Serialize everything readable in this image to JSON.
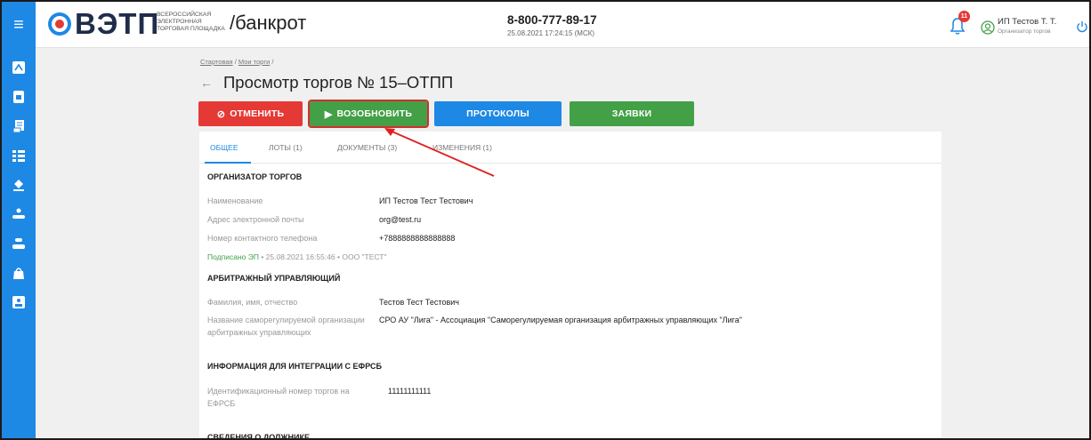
{
  "header": {
    "menu_icon": "hamburger-icon",
    "logo_text": "ВЭТП",
    "logo_sub": [
      "ВСЕРОССИЙСКАЯ",
      "ЭЛЕКТРОННАЯ",
      "ТОРГОВАЯ ПЛОЩАДКА"
    ],
    "section": "/банкрот",
    "phone": "8-800-777-89-17",
    "datetime": "25.08.2021 17:24:15 (МСК)",
    "notifications_count": "11",
    "user_name": "ИП Тестов Т. Т.",
    "user_role": "Организатор торгов"
  },
  "sidebar": {
    "items": [
      {
        "icon": "dashboard-icon"
      },
      {
        "icon": "document-icon"
      },
      {
        "icon": "receipt-icon"
      },
      {
        "icon": "list-icon"
      },
      {
        "icon": "auction-icon"
      },
      {
        "icon": "hand-icon"
      },
      {
        "icon": "hand-coin-icon"
      },
      {
        "icon": "bag-icon"
      },
      {
        "icon": "id-card-icon"
      }
    ]
  },
  "breadcrumb": {
    "home": "Стартовая",
    "sep": "/",
    "my_auctions": "Мои торги",
    "trailing": "/"
  },
  "page": {
    "title": "Просмотр торгов № 15–ОТПП"
  },
  "actions": {
    "cancel": "ОТМЕНИТЬ",
    "resume": "ВОЗОБНОВИТЬ",
    "protocols": "ПРОТОКОЛЫ",
    "bids": "ЗАЯВКИ"
  },
  "tabs": [
    {
      "label": "ОБЩЕЕ",
      "active": true
    },
    {
      "label": "ЛОТЫ (1)",
      "active": false
    },
    {
      "label": "ДОКУМЕНТЫ (3)",
      "active": false
    },
    {
      "label": "ИЗМЕНЕНИЯ (1)",
      "active": false
    }
  ],
  "organizer": {
    "title": "ОРГАНИЗАТОР ТОРГОВ",
    "name_label": "Наименование",
    "name_value": "ИП Тестов Тест Тестович",
    "email_label": "Адрес электронной почты",
    "email_value": "org@test.ru",
    "phone_label": "Номер контактного телефона",
    "phone_value": "+7888888888888888",
    "signed_prefix": "Подписано ЭП",
    "signed_rest": " • 25.08.2021 16:55:46 • ООО \"ТЕСТ\""
  },
  "manager": {
    "title": "АРБИТРАЖНЫЙ УПРАВЛЯЮЩИЙ",
    "fio_label": "Фамилия, имя, отчество",
    "fio_value": "Тестов Тест Тестович",
    "sro_label": "Название саморегулируемой организации арбитражных управляющих",
    "sro_value": "СРО АУ \"Лига\" - Ассоциация \"Саморегулируемая организация арбитражных управляющих \"Лига\""
  },
  "efrsb": {
    "title": "ИНФОРМАЦИЯ ДЛЯ ИНТЕГРАЦИИ С ЕФРСБ",
    "id_label": "Идентификационный номер торгов на ЕФРСБ",
    "id_value": "11111111111"
  },
  "debtor": {
    "title": "СВЕДЕНИЯ О ДОЛЖНИКЕ"
  },
  "colors": {
    "brand_blue": "#1e88e5",
    "danger_red": "#e53935",
    "success_green": "#43a047"
  }
}
